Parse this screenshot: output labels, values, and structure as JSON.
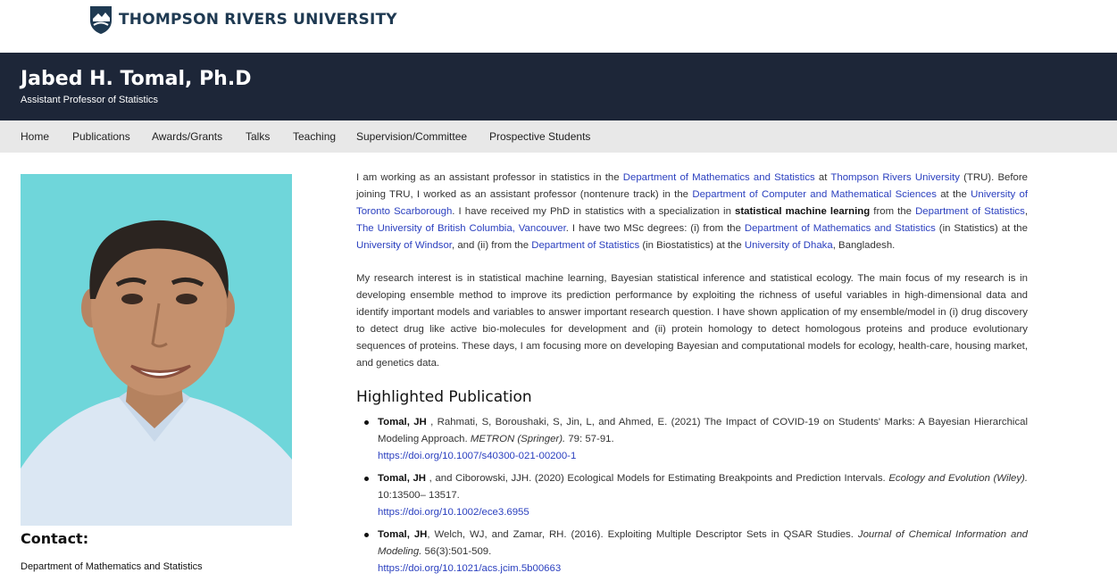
{
  "header": {
    "university": "THOMPSON RIVERS UNIVERSITY",
    "name": "Jabed H. Tomal, Ph.D",
    "role": "Assistant Professor of Statistics"
  },
  "nav": [
    "Home",
    "Publications",
    "Awards/Grants",
    "Talks",
    "Teaching",
    "Supervision/Committee",
    "Prospective Students"
  ],
  "intro": {
    "t1": "I am working as an assistant professor in statistics in the ",
    "l1": "Department of Mathematics and Statistics",
    "t2": " at ",
    "l2": "Thompson Rivers University",
    "t3": " (TRU). Before joining TRU, I worked as an assistant professor (nontenure track) in the ",
    "l3": "Department of Computer and Mathematical Sciences",
    "t4": " at the ",
    "l4": "University of Toronto Scarborough",
    "t5": ". I have received my PhD in statistics with a specialization in ",
    "b1": "statistical machine learning",
    "t6": " from the ",
    "l5": "Department of Statistics",
    "t7": ", ",
    "l6": "The University of British Columbia, Vancouver",
    "t8": ". I have two MSc degrees: (i) from the ",
    "l7": "Department of Mathematics and Statistics",
    "t9": " (in Statistics) at the ",
    "l8": "University of Windsor",
    "t10": ", and (ii) from the ",
    "l9": "Department of Statistics",
    "t11": " (in Biostatistics) at the ",
    "l10": "University of Dhaka",
    "t12": ", Bangladesh."
  },
  "research": "My research interest is in statistical machine learning, Bayesian statistical inference and statistical ecology. The main focus of my research is in developing ensemble method to improve its prediction performance by exploiting the richness of useful variables in high-dimensional data and identify important models and variables to answer important research question. I have shown application of my ensemble/model in (i) drug discovery to detect drug like active bio-molecules for development and (ii) protein homology to detect homologous proteins and produce evolutionary sequences of proteins. These days, I am focusing more on developing Bayesian and computational models for ecology, health-care, housing market, and genetics data.",
  "highlighted_heading": "Highlighted Publication",
  "publications": [
    {
      "author": "Tomal, JH",
      "rest": " , Rahmati, S, Boroushaki, S, Jin, L, and Ahmed, E. (2021) The Impact of COVID-19 on Students' Marks: A Bayesian Hierarchical Modeling Approach. ",
      "journal": "METRON (Springer).",
      "tail": " 79: 57-91.",
      "doi": "https://doi.org/10.1007/s40300-021-00200-1"
    },
    {
      "author": "Tomal, JH",
      "rest": " , and Ciborowski, JJH. (2020) Ecological Models for Estimating Breakpoints and Prediction Intervals. ",
      "journal": "Ecology and Evolution (Wiley).",
      "tail": " 10:13500– 13517.",
      "doi": "https://doi.org/10.1002/ece3.6955"
    },
    {
      "author": "Tomal, JH",
      "rest": ", Welch, WJ, and Zamar, RH. (2016). Exploiting Multiple Descriptor Sets in QSAR Studies. ",
      "journal": "Journal of Chemical Information and Modeling.",
      "tail": " 56(3):501-509.",
      "doi": "https://doi.org/10.1021/acs.jcim.5b00663"
    }
  ],
  "contact": {
    "heading": "Contact:",
    "department": "Department of Mathematics and Statistics"
  },
  "colors": {
    "banner": "#1d2638",
    "nav_bg": "#e8e8e8",
    "link": "#2a3fbf",
    "photo_bg": "#6fd6da"
  }
}
